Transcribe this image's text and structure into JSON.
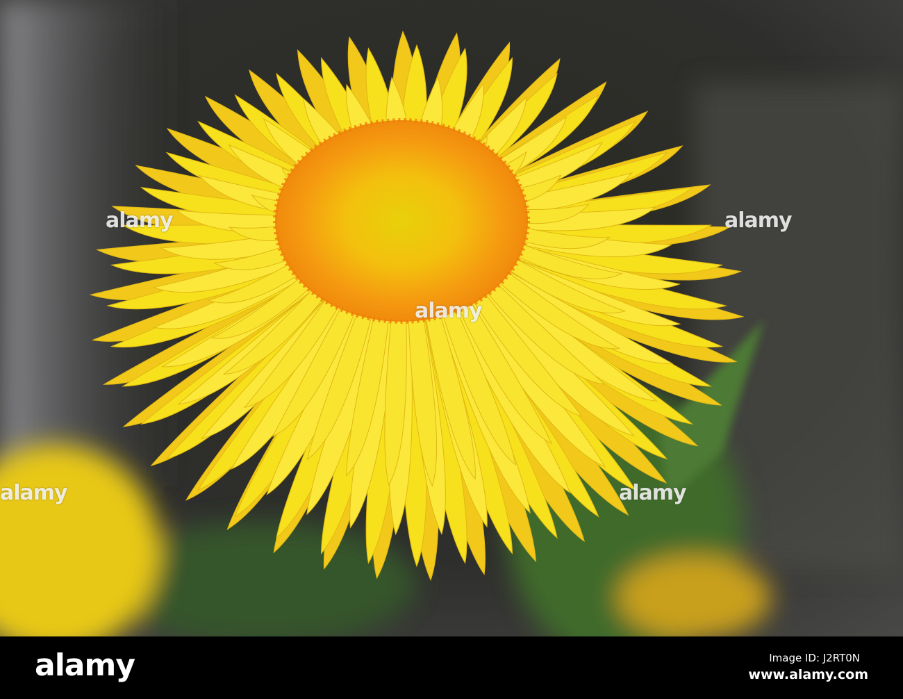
{
  "watermark": {
    "text": "alamy"
  },
  "footer": {
    "logo": "alamy",
    "image_id": "Image ID: J2RT0N",
    "site": "www.alamy.com"
  },
  "colors": {
    "petal": "#f7e01c",
    "disc": "#f59a10",
    "background": "#2a2a28",
    "leaf": "#3f6b2c"
  }
}
